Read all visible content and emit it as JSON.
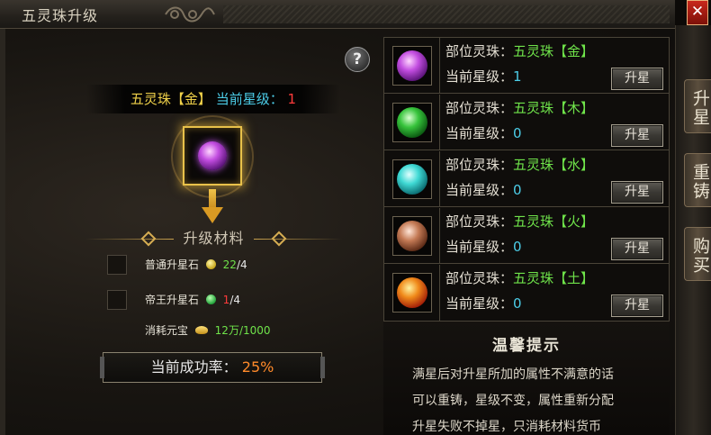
{
  "window": {
    "title": "五灵珠升级"
  },
  "side_tabs": [
    "升星",
    "重铸",
    "购买"
  ],
  "header": {
    "name": "五灵珠【金】",
    "star_label": "当前星级：",
    "star_value": "1"
  },
  "materials": {
    "title": "升级材料",
    "items": [
      {
        "name": "普通升星石",
        "have": "22",
        "need": "/4",
        "have_color": "#6fe34a"
      },
      {
        "name": "帝王升星石",
        "have": "1",
        "need": "/4",
        "have_color": "#ff3b3b"
      }
    ],
    "yuanbao": {
      "label": "消耗元宝",
      "value": "12万/1000"
    }
  },
  "success_rate": {
    "label": "当前成功率：",
    "value": "25%"
  },
  "parts": [
    {
      "label": "部位灵珠：",
      "name": "五灵珠【金】",
      "star_label": "当前星级：",
      "star": "1",
      "button": "升星",
      "orb": "purple"
    },
    {
      "label": "部位灵珠：",
      "name": "五灵珠【木】",
      "star_label": "当前星级：",
      "star": "0",
      "button": "升星",
      "orb": "green"
    },
    {
      "label": "部位灵珠：",
      "name": "五灵珠【水】",
      "star_label": "当前星级：",
      "star": "0",
      "button": "升星",
      "orb": "cyan"
    },
    {
      "label": "部位灵珠：",
      "name": "五灵珠【火】",
      "star_label": "当前星级：",
      "star": "0",
      "button": "升星",
      "orb": "brown"
    },
    {
      "label": "部位灵珠：",
      "name": "五灵珠【土】",
      "star_label": "当前星级：",
      "star": "0",
      "button": "升星",
      "orb": "orange"
    }
  ],
  "tips": {
    "title": "温馨提示",
    "lines": [
      "满星后对升星所加的属性不满意的话",
      "可以重铸，星级不变，属性重新分配",
      "升星失败不掉星，只消耗材料货币"
    ]
  },
  "close_label": "✕",
  "help_label": "?"
}
